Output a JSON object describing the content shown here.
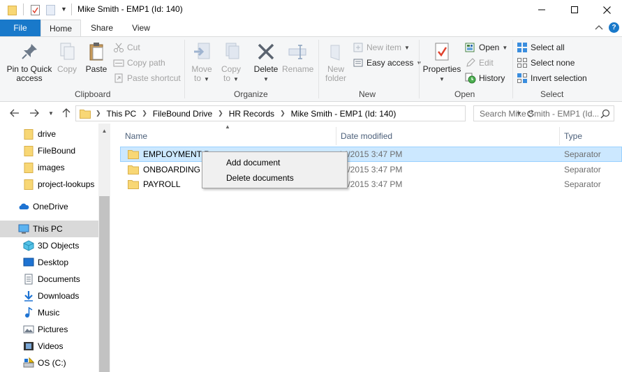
{
  "window": {
    "title": "Mike Smith - EMP1 (Id: 140)"
  },
  "tabs": {
    "file": "File",
    "home": "Home",
    "share": "Share",
    "view": "View",
    "help": "?"
  },
  "ribbon": {
    "clipboard": {
      "label": "Clipboard",
      "pin_line1": "Pin to Quick",
      "pin_line2": "access",
      "copy": "Copy",
      "paste": "Paste",
      "cut": "Cut",
      "copy_path": "Copy path",
      "paste_shortcut": "Paste shortcut"
    },
    "organize": {
      "label": "Organize",
      "move_to_line1": "Move",
      "move_to_line2": "to",
      "copy_to_line1": "Copy",
      "copy_to_line2": "to",
      "delete": "Delete",
      "rename": "Rename"
    },
    "new": {
      "label": "New",
      "new_folder_line1": "New",
      "new_folder_line2": "folder",
      "new_item": "New item",
      "easy_access": "Easy access"
    },
    "open": {
      "label": "Open",
      "properties": "Properties",
      "open": "Open",
      "edit": "Edit",
      "history": "History"
    },
    "select": {
      "label": "Select",
      "select_all": "Select all",
      "select_none": "Select none",
      "invert_selection": "Invert selection"
    }
  },
  "address": {
    "crumbs": [
      "This PC",
      "FileBound Drive",
      "HR Records",
      "Mike Smith - EMP1 (Id: 140)"
    ],
    "search_placeholder": "Search Mike Smith - EMP1 (Id..."
  },
  "navpane": {
    "items": [
      {
        "label": "drive",
        "icon": "folder-icon"
      },
      {
        "label": "FileBound",
        "icon": "folder-icon"
      },
      {
        "label": "images",
        "icon": "folder-icon"
      },
      {
        "label": "project-lookups",
        "icon": "folder-icon"
      },
      {
        "label": "OneDrive",
        "icon": "cloud-icon"
      },
      {
        "label": "This PC",
        "icon": "computer-icon"
      },
      {
        "label": "3D Objects",
        "icon": "cube-icon"
      },
      {
        "label": "Desktop",
        "icon": "desktop-icon"
      },
      {
        "label": "Documents",
        "icon": "document-icon"
      },
      {
        "label": "Downloads",
        "icon": "download-icon"
      },
      {
        "label": "Music",
        "icon": "music-icon"
      },
      {
        "label": "Pictures",
        "icon": "picture-icon"
      },
      {
        "label": "Videos",
        "icon": "video-icon"
      },
      {
        "label": "OS (C:)",
        "icon": "drive-icon"
      }
    ]
  },
  "filelist": {
    "columns": {
      "name": "Name",
      "date": "Date modified",
      "type": "Type"
    },
    "rows": [
      {
        "name": "EMPLOYMENT R",
        "date": "14/2015 3:47 PM",
        "type": "Separator"
      },
      {
        "name": "ONBOARDING C",
        "date": "14/2015 3:47 PM",
        "type": "Separator"
      },
      {
        "name": "PAYROLL",
        "date": "14/2015 3:47 PM",
        "type": "Separator"
      }
    ]
  },
  "context_menu": {
    "add_document": "Add document",
    "delete_documents": "Delete documents"
  },
  "colors": {
    "accent": "#1979ca",
    "selection": "#cce8ff",
    "folder": "#f8d775"
  }
}
